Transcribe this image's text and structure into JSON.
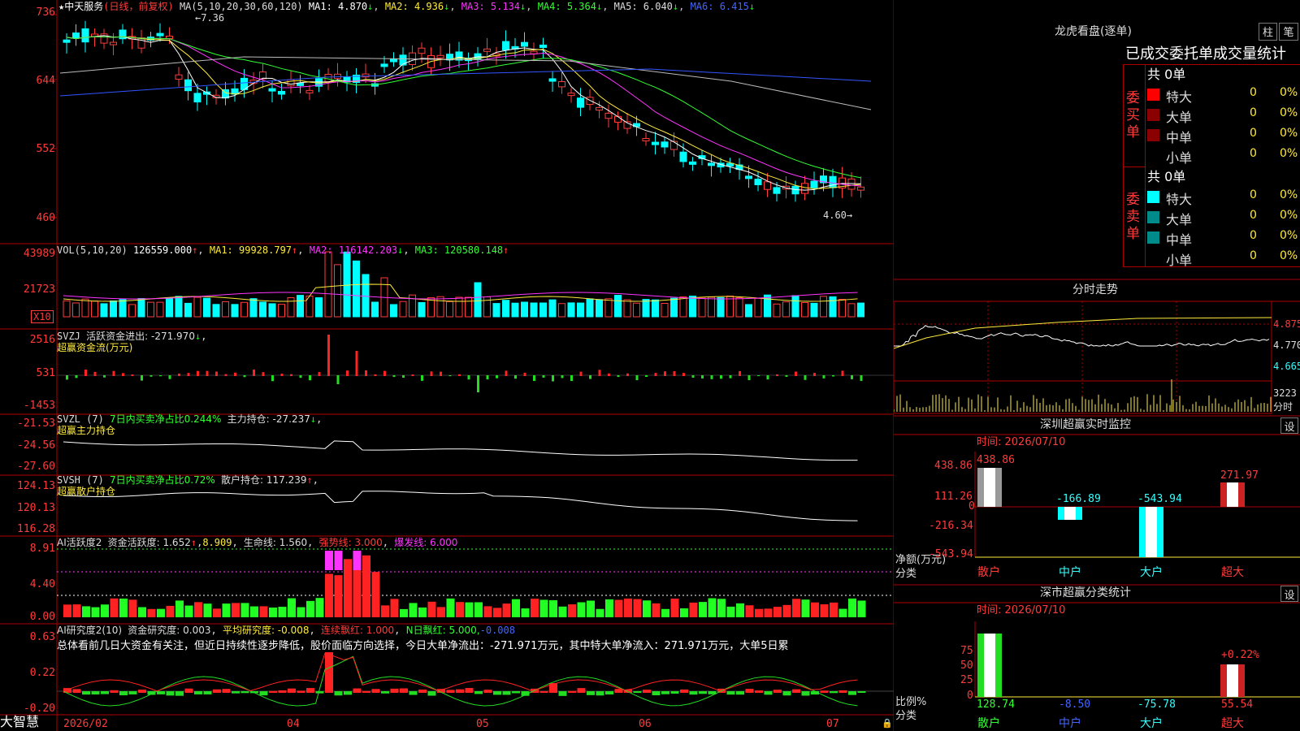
{
  "stock": {
    "name": "中天服务",
    "mode": "(日线，前复权)",
    "ma_text": "MA(5,10,20,30,60,120)",
    "ma1": "MA1: 4.870",
    "ma2": "MA2: 4.936",
    "ma3": "MA3: 5.134",
    "ma4": "MA4: 5.364",
    "ma5": "MA5: 6.040",
    "ma6": "MA6: 6.415",
    "high_label": "7.36",
    "low_label": "4.60"
  },
  "price_axis": [
    "736",
    "644",
    "552",
    "460"
  ],
  "vol": {
    "title": "VOL(5,10,20)",
    "val": "126559.000",
    "ma1": "MA1: 99928.797",
    "ma2": "MA2: 116142.203",
    "ma3": "MA3: 120580.148",
    "axis": [
      "43989",
      "21723"
    ],
    "unit": "X10"
  },
  "svzj": {
    "title": "SVZJ",
    "line1": "活跃资金进出: -271.970",
    "line2": "超赢资金流(万元)",
    "axis": [
      "2516",
      "531",
      "-1453"
    ]
  },
  "svzl": {
    "title": "SVZL (7)",
    "desc": "7日内买卖净占比0.244%",
    "label": "主力持仓: -27.237",
    "line2": "超赢主力持仓",
    "axis": [
      "-21.53",
      "-24.56",
      "-27.60"
    ]
  },
  "svsh": {
    "title": "SVSH (7)",
    "desc": "7日内买卖净占比0.72%",
    "label": "散户持仓: 117.239",
    "line2": "超赢散户持仓",
    "axis": [
      "124.13",
      "120.13",
      "116.28"
    ]
  },
  "ai": {
    "title": "AI活跃度2",
    "label": "资金活跃度: 1.652",
    "v2": "8.909",
    "life": "生命线: 1.560",
    "strong": "强势线: 3.000",
    "burst": "爆发线: 6.000",
    "axis": [
      "8.91",
      "4.40",
      "0.00"
    ]
  },
  "ai2": {
    "title": "AI研究度2(10)",
    "label": "资金研究度: 0.003",
    "avg": "平均研究度: -0.008",
    "red": "连续飘红: 1.000",
    "nred": "N日飘红: 5.000,",
    "nred2": "-0.008",
    "summary": "总体看前几日大资金有关注，但近日持续性逐步降低，股价面临方向选择，今日大单净流出：-271.971万元，其中特大单净流入：271.971万元，大单5日累",
    "axis": [
      "0.63",
      "0.22",
      "-0.20"
    ]
  },
  "dates": [
    "2026/02",
    "04",
    "05",
    "06",
    "07"
  ],
  "app_name": "大智慧",
  "right": {
    "lhb_title": "龙虎看盘(逐单)",
    "btn_bar": "柱",
    "btn_line": "笔",
    "stats_title": "已成交委托单成交量统计",
    "buy_label": "委买单",
    "sell_label": "委卖单",
    "buy_total": "共 0单",
    "sell_total": "共 0单",
    "rows": [
      {
        "name": "特大",
        "value": "0",
        "pct": "0%"
      },
      {
        "name": "大单",
        "value": "0",
        "pct": "0%"
      },
      {
        "name": "中单",
        "value": "0",
        "pct": "0%"
      },
      {
        "name": "小单",
        "value": "0",
        "pct": "0%"
      }
    ],
    "colors": {
      "buy": [
        "#ff0000",
        "#8b0000",
        "#8b0000",
        "#000000"
      ],
      "sell": [
        "#00ffff",
        "#008b8b",
        "#008b8b",
        "#000000"
      ]
    },
    "intraday_title": "分时走势",
    "intraday_axis": [
      "4.875",
      "4.770",
      "4.665"
    ],
    "intraday_vol": "3223",
    "intraday_unit": "分时",
    "sz_title": "深圳超赢实时监控",
    "set": "设",
    "time_label": "时间: 2026/07/10",
    "sz_axis": [
      "438.86",
      "111.26",
      "0",
      "-216.34",
      "-543.94"
    ],
    "sz_unit": "净额(万元)",
    "cat_label": "分类",
    "sz_bars": [
      {
        "name": "散户",
        "value": "438.86"
      },
      {
        "name": "中户",
        "value": "-166.89"
      },
      {
        "name": "大户",
        "value": "-543.94"
      },
      {
        "name": "超大",
        "value": "271.97"
      }
    ],
    "cls_title": "深市超赢分类统计",
    "cls_axis": [
      "75",
      "50",
      "25",
      "0"
    ],
    "cls_unit": "比例%",
    "cls_top": "+0.22%",
    "cls_vals": [
      {
        "name": "散户",
        "value": "128.74"
      },
      {
        "name": "中户",
        "value": "-8.50"
      },
      {
        "name": "大户",
        "value": "-75.78"
      },
      {
        "name": "超大",
        "value": "55.54"
      }
    ]
  }
}
